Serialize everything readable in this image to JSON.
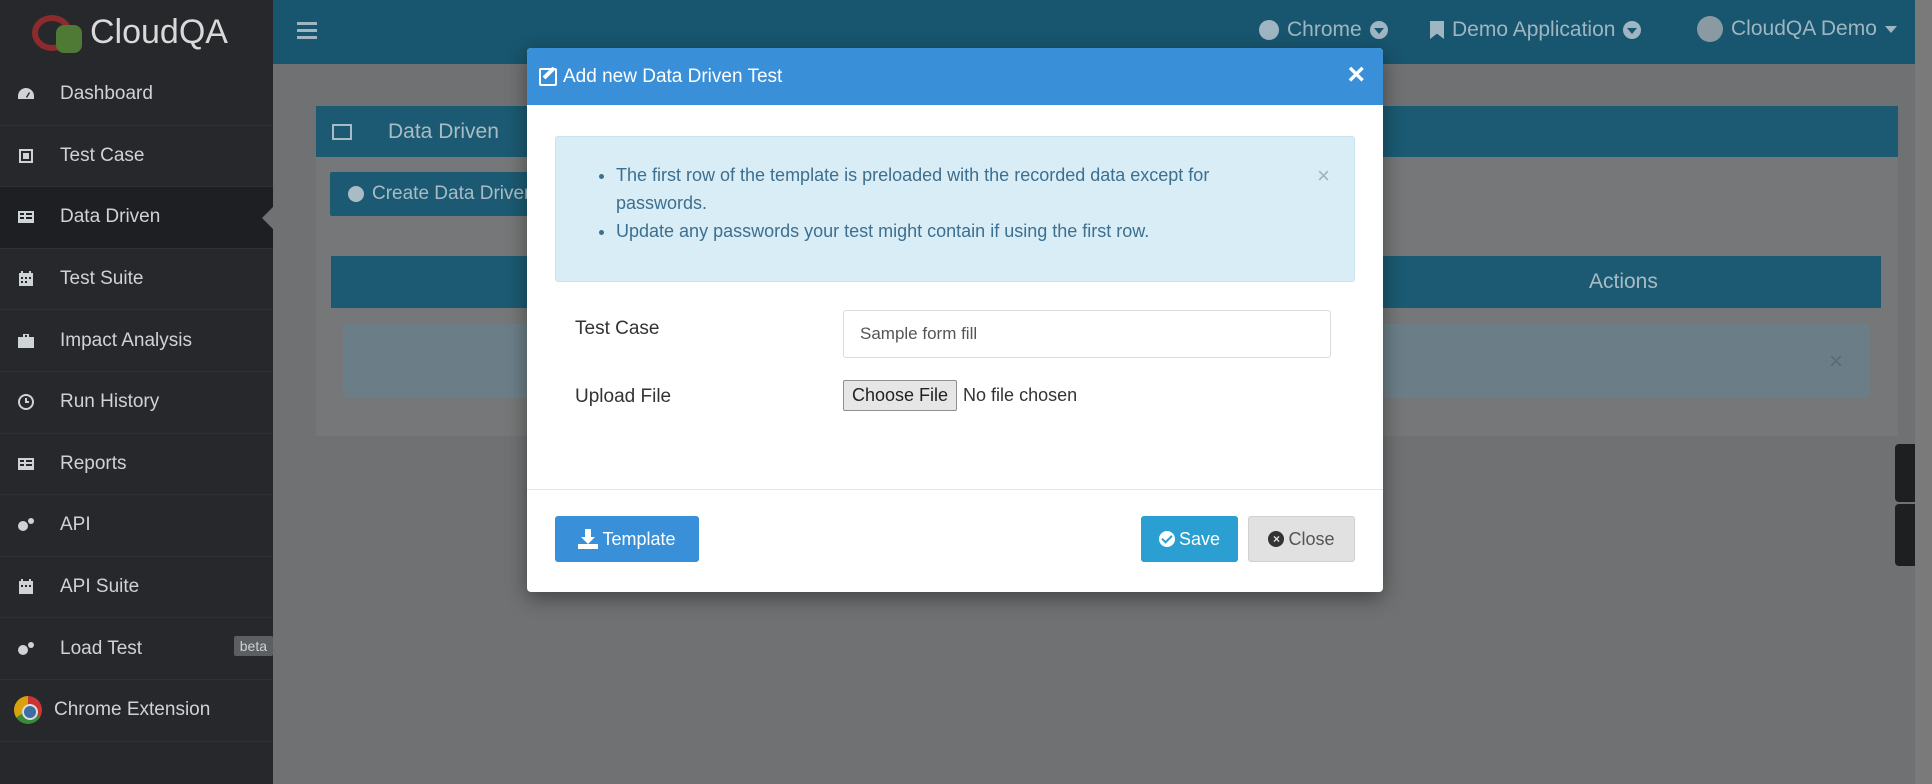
{
  "brand": {
    "name": "CloudQA"
  },
  "sidebar": {
    "items": [
      {
        "label": "Dashboard",
        "icon": "dashboard-icon"
      },
      {
        "label": "Test Case",
        "icon": "test-case-icon"
      },
      {
        "label": "Data Driven",
        "icon": "table-icon",
        "active": true
      },
      {
        "label": "Test Suite",
        "icon": "calendar-icon"
      },
      {
        "label": "Impact Analysis",
        "icon": "briefcase-icon"
      },
      {
        "label": "Run History",
        "icon": "clock-icon"
      },
      {
        "label": "Reports",
        "icon": "table-icon"
      },
      {
        "label": "API",
        "icon": "gears-icon"
      },
      {
        "label": "API Suite",
        "icon": "calendar-icon"
      },
      {
        "label": "Load Test",
        "icon": "gears-icon",
        "badge": "beta"
      },
      {
        "label": "Chrome Extension",
        "icon": "chrome-icon"
      }
    ]
  },
  "topbar": {
    "browser": "Chrome",
    "application": "Demo Application",
    "user": "CloudQA Demo"
  },
  "page": {
    "title": "Data Driven",
    "create_button": "Create Data Driven Test",
    "table_actions_header": "Actions"
  },
  "modal": {
    "title": "Add new Data Driven Test",
    "alert_items": [
      "The first row of the template is preloaded with the recorded data except for passwords.",
      "Update any passwords your test might contain if using the first row."
    ],
    "test_case_label": "Test Case",
    "test_case_value": "Sample form fill",
    "upload_label": "Upload File",
    "choose_file_label": "Choose File",
    "no_file_text": "No file chosen",
    "template_button": "Template",
    "save_button": "Save",
    "close_button": "Close"
  },
  "colors": {
    "modal_header": "#3a8fd9",
    "topbar": "#18556e",
    "sidebar": "#26282b",
    "alert_bg": "#d9edf7",
    "save": "#2b9fd1"
  }
}
